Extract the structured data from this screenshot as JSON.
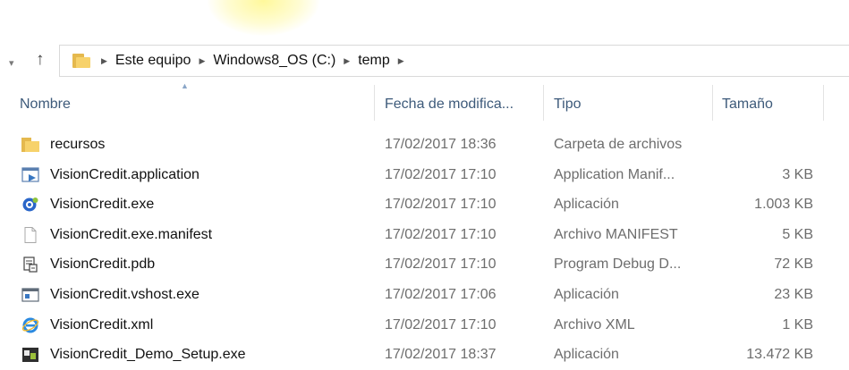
{
  "addressbar": {
    "breadcrumbs": [
      "Este equipo",
      "Windows8_OS (C:)",
      "temp"
    ]
  },
  "columns": {
    "name": "Nombre",
    "date": "Fecha de modifica...",
    "type": "Tipo",
    "size": "Tamaño"
  },
  "files": [
    {
      "name": "recursos",
      "date": "17/02/2017 18:36",
      "type": "Carpeta de archivos",
      "size": "",
      "icon": "folder-icon"
    },
    {
      "name": "VisionCredit.application",
      "date": "17/02/2017 17:10",
      "type": "Application Manif...",
      "size": "3 KB",
      "icon": "application-manifest-icon"
    },
    {
      "name": "VisionCredit.exe",
      "date": "17/02/2017 17:10",
      "type": "Aplicación",
      "size": "1.003 KB",
      "icon": "app-exe-icon"
    },
    {
      "name": "VisionCredit.exe.manifest",
      "date": "17/02/2017 17:10",
      "type": "Archivo MANIFEST",
      "size": "5 KB",
      "icon": "blank-file-icon"
    },
    {
      "name": "VisionCredit.pdb",
      "date": "17/02/2017 17:10",
      "type": "Program Debug D...",
      "size": "72 KB",
      "icon": "pdb-file-icon"
    },
    {
      "name": "VisionCredit.vshost.exe",
      "date": "17/02/2017 17:06",
      "type": "Aplicación",
      "size": "23 KB",
      "icon": "window-exe-icon"
    },
    {
      "name": "VisionCredit.xml",
      "date": "17/02/2017 17:10",
      "type": "Archivo XML",
      "size": "1 KB",
      "icon": "internet-explorer-icon"
    },
    {
      "name": "VisionCredit_Demo_Setup.exe",
      "date": "17/02/2017 18:37",
      "type": "Aplicación",
      "size": "13.472 KB",
      "icon": "setup-exe-icon"
    }
  ],
  "colors": {
    "header_text": "#3d5a7a",
    "folder": "#f7d26b",
    "secondary_text": "#6d6d6d"
  }
}
